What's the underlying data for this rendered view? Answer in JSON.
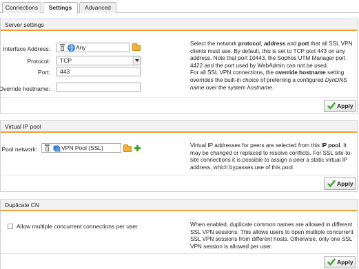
{
  "tabs": [
    {
      "label": "Connections",
      "active": false
    },
    {
      "label": "Settings",
      "active": true
    },
    {
      "label": "Advanced",
      "active": false
    }
  ],
  "server": {
    "title": "Server settings",
    "interface_label": "Interface Address:",
    "interface_value": "Any",
    "protocol_label": "Protocol:",
    "protocol_value": "TCP",
    "port_label": "Port:",
    "port_value": "443",
    "override_label": "Override hostname:",
    "override_value": "",
    "apply_label": "Apply",
    "help": {
      "t1": "Select the network ",
      "b1": "protocol",
      "t2": ", ",
      "b2": "address",
      "t3": " and ",
      "b3": "port",
      "t4": " that all SSL VPN clients must use. By default, this is set to TCP port 443 on any address. Note that port 10443, the Sophos UTM Manager port 4422 and the port used by WebAdmin can not be used.",
      "t5": "For all SSL VPN connections, the ",
      "b4": "override hostname",
      "t6": " setting overrides the built-in choice of preferring a configured ",
      "i1": "DynDNS name",
      "t7": " over the system ",
      "i2": "hostname",
      "t8": "."
    }
  },
  "vip": {
    "title": "Virtual IP pool",
    "pool_label": "Pool network:",
    "pool_value": "VPN Pool (SSL)",
    "apply_label": "Apply",
    "help": {
      "t1": "Virtual IP addresses for peers are selected from this ",
      "b1": "IP pool",
      "t2": ". It may be changed or replaced to resolve conflicts. For SSL site-to-site connections it is possible to assign a peer a static virtual IP address, which bypasses use of this pool."
    }
  },
  "dupcn": {
    "title": "Duplicate CN",
    "checkbox_label": "Allow multiple concurrent connections per user",
    "checked": false,
    "apply_label": "Apply",
    "help": "When enabled, duplicate common names are allowed in different SSL VPN sessions. This allows users to open multiple concurrent SSL VPN sessions from different hosts. Otherwise, only one SSL VPN session is allowed per user."
  },
  "colors": {
    "accent": "#f29c38",
    "apply_check": "#3aa12a",
    "folder": "#f0b23a"
  },
  "icons": [
    "trash-icon",
    "network-any-icon",
    "folder-icon",
    "network-pool-icon",
    "plus-icon",
    "check-icon"
  ]
}
